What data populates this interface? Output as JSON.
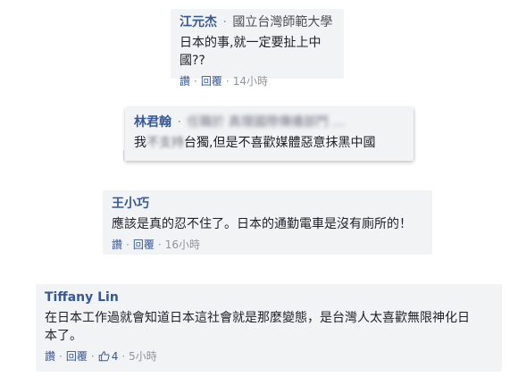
{
  "comments": [
    {
      "author": "江元杰",
      "affiliation": "國立台灣師範大學",
      "text": "日本的事,就一定要扯上中國??",
      "actions": {
        "read": "讚",
        "reply": "回覆",
        "time": "14小時"
      }
    },
    {
      "author": "林君翰",
      "affiliation_blurred": "任職於 真理國際傳播部門 …",
      "text_prefix": "我",
      "text_blurred": "不支持",
      "text_suffix": "台獨,但是不喜歡媒體惡意抹黑中國"
    },
    {
      "author": "王小巧",
      "text": "應該是真的忍不住了。日本的通勤電車是沒有廁所的！",
      "actions": {
        "read": "讚",
        "reply": "回覆",
        "time": "16小時"
      }
    },
    {
      "author": "Tiffany Lin",
      "text_line1": "在日本工作過就會知道日本這社會就是那麼變態，是台灣人太喜歡無限神化日",
      "text_line2": "本了。",
      "actions": {
        "read": "讚",
        "reply": "回覆",
        "likes": "4",
        "time": "5小時"
      }
    }
  ],
  "icons": {
    "like": "thumbs-up-icon"
  },
  "colors": {
    "link": "#365899",
    "muted": "#90949c",
    "card_bg": "#f2f3f5"
  }
}
